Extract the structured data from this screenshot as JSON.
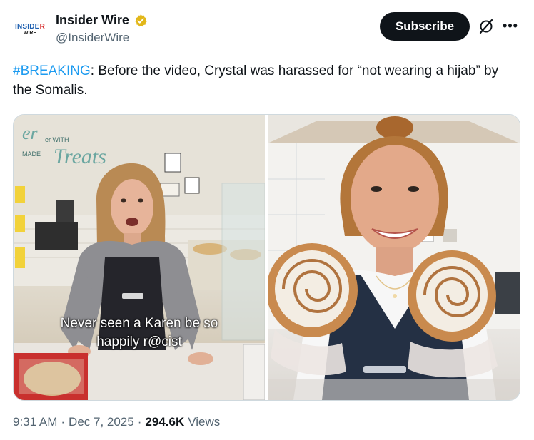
{
  "account": {
    "display_name": "Insider Wire",
    "handle": "@InsiderWire",
    "avatar_line1_a": "INSIDE",
    "avatar_line1_b": "R",
    "avatar_line2": "WIRE"
  },
  "actions": {
    "subscribe_label": "Subscribe",
    "more_icon": "more-icon",
    "grok_icon": "grok-icon"
  },
  "tweet": {
    "hashtag": "#BREAKING",
    "body": ": Before the video, Crystal was harassed for “not wearing a hijab” by the Somalis."
  },
  "media": {
    "left_store_sign_1": "er WITH",
    "left_store_sign_2": "MADE",
    "left_store_sign_3": "Treats",
    "caption": "Never seen a Karen be so happily r@cist"
  },
  "meta": {
    "time": "9:31 AM",
    "date": "Dec 7, 2025",
    "views_count": "294.6K",
    "views_label": "Views"
  },
  "colors": {
    "link": "#1d9bf0",
    "text": "#0f1419",
    "muted": "#536471",
    "verified_badge": "#e2b719"
  }
}
